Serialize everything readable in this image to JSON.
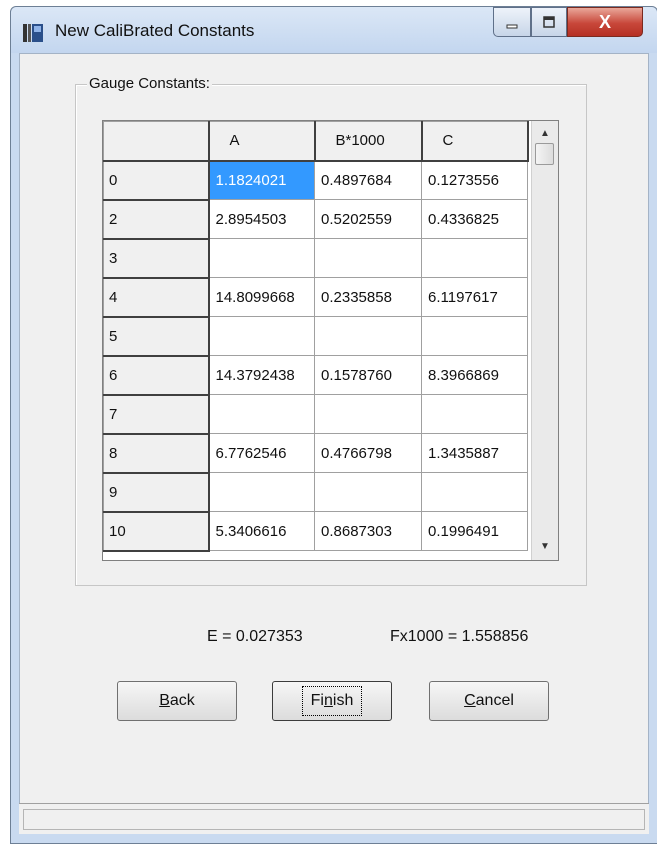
{
  "window": {
    "title": "New CaliBrated Constants",
    "controls": {
      "minimize": "—",
      "maximize": "▢",
      "close": "X"
    }
  },
  "group": {
    "label": "Gauge Constants:"
  },
  "grid": {
    "columns": [
      "",
      "A",
      "B*1000",
      "C"
    ],
    "rows": [
      {
        "label": "0",
        "a": "1.1824021",
        "b": "0.4897684",
        "c": "0.1273556"
      },
      {
        "label": "2",
        "a": "2.8954503",
        "b": "0.5202559",
        "c": "0.4336825"
      },
      {
        "label": "3",
        "a": "",
        "b": "",
        "c": ""
      },
      {
        "label": "4",
        "a": "14.8099668",
        "b": "0.2335858",
        "c": "6.1197617"
      },
      {
        "label": "5",
        "a": "",
        "b": "",
        "c": ""
      },
      {
        "label": "6",
        "a": "14.3792438",
        "b": "0.1578760",
        "c": "8.3966869"
      },
      {
        "label": "7",
        "a": "",
        "b": "",
        "c": ""
      },
      {
        "label": "8",
        "a": "6.7762546",
        "b": "0.4766798",
        "c": "1.3435887"
      },
      {
        "label": "9",
        "a": "",
        "b": "",
        "c": ""
      },
      {
        "label": "10",
        "a": "5.3406616",
        "b": "0.8687303",
        "c": "0.1996491"
      }
    ],
    "scroll_up": "▲",
    "scroll_down": "▼"
  },
  "stats": {
    "e_text": "E =  0.027353",
    "f_text": "Fx1000 =  1.558856"
  },
  "buttons": {
    "back": {
      "mnemonic": "B",
      "rest": "ack"
    },
    "finish": {
      "pre": "Fi",
      "mnemonic": "n",
      "post": "ish"
    },
    "cancel": {
      "mnemonic": "C",
      "rest": "ancel"
    }
  },
  "colors": {
    "selection": "#3399ff",
    "close_button": "#c8473a",
    "frame": "#c9daf0"
  }
}
